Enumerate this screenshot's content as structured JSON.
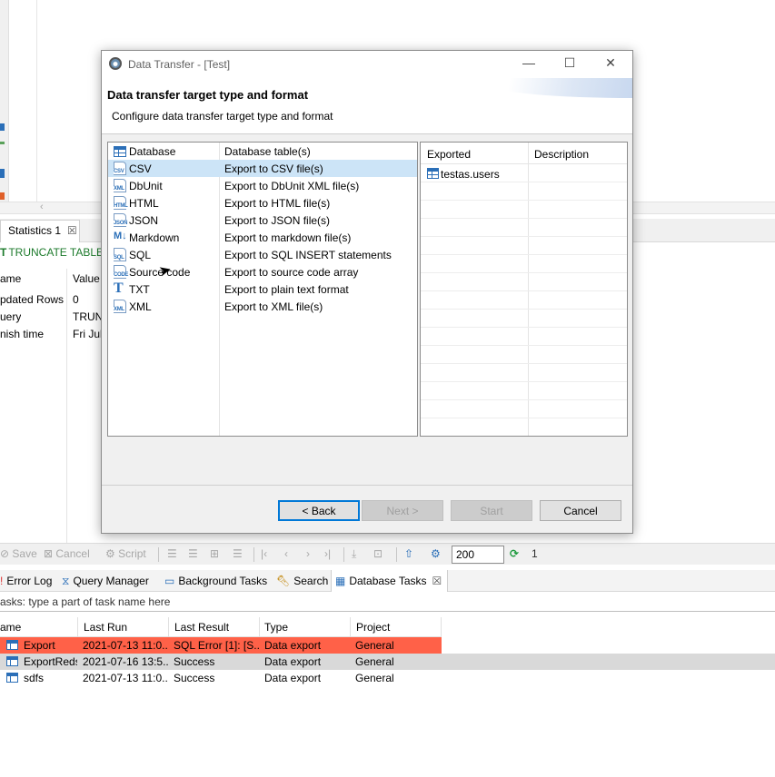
{
  "background": {
    "statistics_tab": {
      "label": "Statistics 1",
      "close": "☒"
    },
    "sql_text": "TRUNCATE TABLE te",
    "stats": {
      "col_name": "ame",
      "col_value": "Value",
      "rows": [
        {
          "name": "pdated Rows",
          "value": "0"
        },
        {
          "name": "uery",
          "value": "TRUNC"
        },
        {
          "name": "nish time",
          "value": "Fri Jul"
        }
      ]
    },
    "toolbar": {
      "save": "Save",
      "cancel": "Cancel",
      "script": "Script",
      "fetch_size": "200",
      "refresh_count": "1"
    },
    "views": {
      "error_log": "Error Log",
      "query_manager": "Query Manager",
      "background_tasks": "Background Tasks",
      "search": "Search",
      "database_tasks": "Database Tasks",
      "close": "☒"
    },
    "filter_text": "asks: type a part of task name here",
    "tasks": {
      "columns": [
        "ame",
        "Last Run",
        "Last Result",
        "Type",
        "Project"
      ],
      "rows": [
        {
          "name": "Export",
          "last_run": "2021-07-13 11:0...",
          "last_result": "SQL Error [1]: [S...",
          "type": "Data export",
          "project": "General",
          "state": "error"
        },
        {
          "name": "ExportReds",
          "last_run": "2021-07-16 13:5...",
          "last_result": "Success",
          "type": "Data export",
          "project": "General",
          "state": "selected"
        },
        {
          "name": "sdfs",
          "last_run": "2021-07-13 11:0...",
          "last_result": "Success",
          "type": "Data export",
          "project": "General",
          "state": "normal"
        }
      ]
    }
  },
  "dialog": {
    "title": "Data Transfer - [Test]",
    "heading": "Data transfer target type and format",
    "subheading": "Configure data transfer target type and format",
    "formats": [
      {
        "name": "Database",
        "desc": "Database table(s)",
        "icon": "database-icon",
        "tag": ""
      },
      {
        "name": "CSV",
        "desc": "Export to CSV file(s)",
        "icon": "csv-file-icon",
        "tag": "CSV"
      },
      {
        "name": "DbUnit",
        "desc": "Export to DbUnit XML file(s)",
        "icon": "xml-file-icon",
        "tag": "XML"
      },
      {
        "name": "HTML",
        "desc": "Export to HTML file(s)",
        "icon": "html-file-icon",
        "tag": "HTML"
      },
      {
        "name": "JSON",
        "desc": "Export to JSON file(s)",
        "icon": "json-file-icon",
        "tag": "JSON"
      },
      {
        "name": "Markdown",
        "desc": "Export to markdown file(s)",
        "icon": "markdown-icon",
        "tag": "M↓"
      },
      {
        "name": "SQL",
        "desc": "Export to SQL INSERT statements",
        "icon": "sql-file-icon",
        "tag": "SQL"
      },
      {
        "name": "Source code",
        "desc": "Export to source code array",
        "icon": "code-file-icon",
        "tag": "CODE"
      },
      {
        "name": "TXT",
        "desc": "Export to plain text format",
        "icon": "text-icon",
        "tag": "T"
      },
      {
        "name": "XML",
        "desc": "Export to XML file(s)",
        "icon": "xml-file-icon",
        "tag": "XML"
      }
    ],
    "selected_format": "CSV",
    "exported": {
      "col_exported": "Exported",
      "col_description": "Description",
      "rows": [
        {
          "name": "testas.users",
          "description": ""
        }
      ]
    },
    "buttons": {
      "back": "< Back",
      "next": "Next >",
      "start": "Start",
      "cancel": "Cancel"
    }
  },
  "colors": {
    "error_row": "#ff6148",
    "selected_row": "#cce4f7",
    "accent": "#0078d7",
    "icon_blue": "#2b6fb8"
  }
}
